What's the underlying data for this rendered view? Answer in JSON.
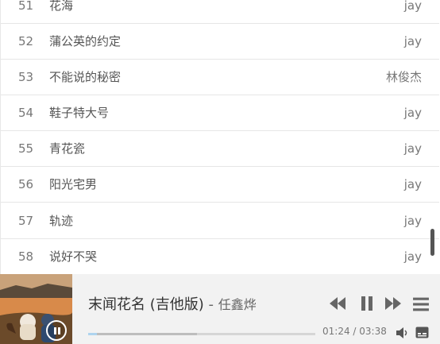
{
  "songs": [
    {
      "num": "51",
      "title": "花海",
      "artist": "jay"
    },
    {
      "num": "52",
      "title": "蒲公英的约定",
      "artist": "jay"
    },
    {
      "num": "53",
      "title": "不能说的秘密",
      "artist": "林俊杰"
    },
    {
      "num": "54",
      "title": "鞋子特大号",
      "artist": "jay"
    },
    {
      "num": "55",
      "title": "青花瓷",
      "artist": "jay"
    },
    {
      "num": "56",
      "title": "阳光宅男",
      "artist": "jay"
    },
    {
      "num": "57",
      "title": "轨迹",
      "artist": "jay"
    },
    {
      "num": "58",
      "title": "说好不哭",
      "artist": "jay"
    }
  ],
  "player": {
    "title": "末闻花名 (吉他版)",
    "separator": " - ",
    "artist": "任鑫烨",
    "current_time": "01:24",
    "time_separator": " / ",
    "duration": "03:38",
    "progress_played": 0.04,
    "progress_loaded": 0.48
  },
  "icons": {
    "prev": "rewind-icon",
    "pause": "pause-icon",
    "next": "fast-forward-icon",
    "menu": "menu-icon",
    "volume": "volume-icon",
    "lyrics": "lyrics-icon"
  },
  "colors": {
    "progress_played": "#aed4ef",
    "progress_loaded": "#bdbdbd",
    "player_bg": "#f2f2f2"
  }
}
